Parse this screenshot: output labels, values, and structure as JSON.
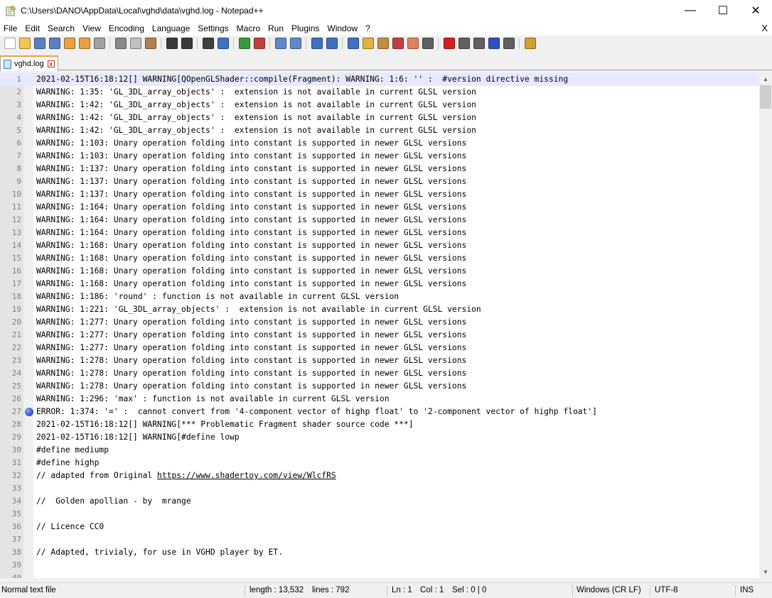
{
  "window": {
    "title": "C:\\Users\\DANO\\AppData\\Local\\vghd\\data\\vghd.log - Notepad++",
    "controls": {
      "minimize": "—",
      "maximize": "☐",
      "close": "✕"
    }
  },
  "menu": {
    "items": [
      "File",
      "Edit",
      "Search",
      "View",
      "Encoding",
      "Language",
      "Settings",
      "Macro",
      "Run",
      "Plugins",
      "Window",
      "?"
    ],
    "close_label": "X"
  },
  "toolbar": {
    "buttons": [
      {
        "name": "new-file",
        "color": "#ffffff"
      },
      {
        "name": "open-file",
        "color": "#f5c453"
      },
      {
        "name": "save-file",
        "color": "#5b7fbf"
      },
      {
        "name": "save-all",
        "color": "#5b7fbf"
      },
      {
        "name": "close-file",
        "color": "#e8a040"
      },
      {
        "name": "close-all",
        "color": "#e8a040"
      },
      {
        "name": "print",
        "color": "#a0a0a0"
      },
      {
        "sep": true
      },
      {
        "name": "cut",
        "color": "#8a8a8a"
      },
      {
        "name": "copy",
        "color": "#c0c0c0"
      },
      {
        "name": "paste",
        "color": "#b08050"
      },
      {
        "sep": true
      },
      {
        "name": "undo",
        "color": "#3a3a3a"
      },
      {
        "name": "redo",
        "color": "#3a3a3a"
      },
      {
        "sep": true
      },
      {
        "name": "find",
        "color": "#404040"
      },
      {
        "name": "replace",
        "color": "#4070c0"
      },
      {
        "sep": true
      },
      {
        "name": "zoom-in",
        "color": "#3a9a3a"
      },
      {
        "name": "zoom-out",
        "color": "#c04040"
      },
      {
        "sep": true
      },
      {
        "name": "sync-vertical",
        "color": "#6088c8"
      },
      {
        "name": "sync-horizontal",
        "color": "#6088c8"
      },
      {
        "sep": true
      },
      {
        "name": "word-wrap",
        "color": "#4070c0"
      },
      {
        "name": "show-all-chars",
        "color": "#4070c0"
      },
      {
        "sep": true
      },
      {
        "name": "indent-guide",
        "color": "#4070c0"
      },
      {
        "name": "user-language",
        "color": "#e0b040"
      },
      {
        "name": "document-map",
        "color": "#c09040"
      },
      {
        "name": "function-list",
        "color": "#c04040"
      },
      {
        "name": "folder-workspace",
        "color": "#e08060"
      },
      {
        "name": "monitoring",
        "color": "#606060"
      },
      {
        "sep": true
      },
      {
        "name": "record-macro",
        "color": "#d02020"
      },
      {
        "name": "stop-macro",
        "color": "#606060"
      },
      {
        "name": "play-macro",
        "color": "#606060"
      },
      {
        "name": "run-macro-multiple",
        "color": "#3050c0"
      },
      {
        "name": "save-macro",
        "color": "#606060"
      },
      {
        "sep": true
      },
      {
        "name": "launch-browser",
        "color": "#d0a030"
      }
    ]
  },
  "tabs": [
    {
      "label": "vghd.log",
      "close": "x"
    }
  ],
  "editor": {
    "current_line": 1,
    "bookmark_line": 27,
    "lines": [
      "2021-02-15T16:18:12[] WARNING[QOpenGLShader::compile(Fragment): WARNING: 1:6: '' :  #version directive missing",
      "WARNING: 1:35: 'GL_3DL_array_objects' :  extension is not available in current GLSL version",
      "WARNING: 1:42: 'GL_3DL_array_objects' :  extension is not available in current GLSL version",
      "WARNING: 1:42: 'GL_3DL_array_objects' :  extension is not available in current GLSL version",
      "WARNING: 1:42: 'GL_3DL_array_objects' :  extension is not available in current GLSL version",
      "WARNING: 1:103: Unary operation folding into constant is supported in newer GLSL versions",
      "WARNING: 1:103: Unary operation folding into constant is supported in newer GLSL versions",
      "WARNING: 1:137: Unary operation folding into constant is supported in newer GLSL versions",
      "WARNING: 1:137: Unary operation folding into constant is supported in newer GLSL versions",
      "WARNING: 1:137: Unary operation folding into constant is supported in newer GLSL versions",
      "WARNING: 1:164: Unary operation folding into constant is supported in newer GLSL versions",
      "WARNING: 1:164: Unary operation folding into constant is supported in newer GLSL versions",
      "WARNING: 1:164: Unary operation folding into constant is supported in newer GLSL versions",
      "WARNING: 1:168: Unary operation folding into constant is supported in newer GLSL versions",
      "WARNING: 1:168: Unary operation folding into constant is supported in newer GLSL versions",
      "WARNING: 1:168: Unary operation folding into constant is supported in newer GLSL versions",
      "WARNING: 1:168: Unary operation folding into constant is supported in newer GLSL versions",
      "WARNING: 1:186: 'round' : function is not available in current GLSL version",
      "WARNING: 1:221: 'GL_3DL_array_objects' :  extension is not available in current GLSL version",
      "WARNING: 1:277: Unary operation folding into constant is supported in newer GLSL versions",
      "WARNING: 1:277: Unary operation folding into constant is supported in newer GLSL versions",
      "WARNING: 1:277: Unary operation folding into constant is supported in newer GLSL versions",
      "WARNING: 1:278: Unary operation folding into constant is supported in newer GLSL versions",
      "WARNING: 1:278: Unary operation folding into constant is supported in newer GLSL versions",
      "WARNING: 1:278: Unary operation folding into constant is supported in newer GLSL versions",
      "WARNING: 1:296: 'max' : function is not available in current GLSL version",
      "ERROR: 1:374: '=' :  cannot convert from '4-component vector of highp float' to '2-component vector of highp float']",
      "2021-02-15T16:18:12[] WARNING[*** Problematic Fragment shader source code ***]",
      "2021-02-15T16:18:12[] WARNING[#define lowp",
      "#define mediump",
      "#define highp",
      {
        "prefix": "// adapted from Original ",
        "link": "https://www.shadertoy.com/view/WlcfRS"
      },
      "",
      "//  Golden apollian - by  mrange",
      "",
      "// Licence CC0",
      "",
      "// Adapted, trivialy, for use in VGHD player by ET.",
      "",
      ""
    ]
  },
  "status": {
    "type": "Normal text file",
    "length": "length : 13,532",
    "lines": "lines : 792",
    "ln": "Ln : 1",
    "col": "Col : 1",
    "sel": "Sel : 0 | 0",
    "eol": "Windows (CR LF)",
    "encoding": "UTF-8",
    "mode": "INS"
  }
}
